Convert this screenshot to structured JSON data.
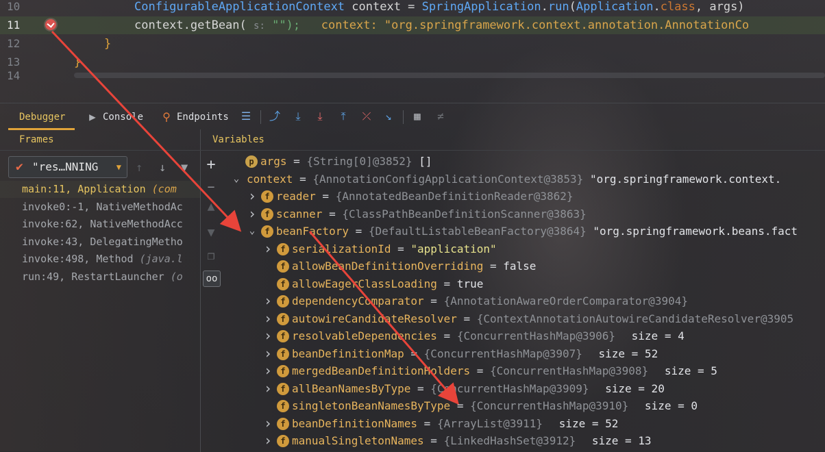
{
  "editor": {
    "lines": [
      {
        "num": "10",
        "text": "ConfigurableApplicationContext context = SpringApplication.run(Application.class, args)"
      },
      {
        "num": "11",
        "code_main": "context.getBean(",
        "param_hint": "s:",
        "code_arg": "\"\");",
        "inline_value": "context: \"org.springframework.context.annotation.AnnotationCo"
      },
      {
        "num": "12",
        "text": "}"
      },
      {
        "num": "13",
        "text": "}"
      },
      {
        "num": "14",
        "text": ""
      }
    ]
  },
  "toolbar": {
    "tabs": [
      "Debugger",
      "Console",
      "Endpoints"
    ]
  },
  "frames": {
    "header": "Frames",
    "thread": "\"res…NNING",
    "items": [
      {
        "main": "main:11, Application",
        "detail": "(com"
      },
      {
        "main": "invoke0:-1, NativeMethodAc",
        "detail": ""
      },
      {
        "main": "invoke:62, NativeMethodAcc",
        "detail": ""
      },
      {
        "main": "invoke:43, DelegatingMetho",
        "detail": ""
      },
      {
        "main": "invoke:498, Method",
        "detail": "(java.l"
      },
      {
        "main": "run:49, RestartLauncher",
        "detail": "(o"
      }
    ]
  },
  "variables": {
    "header": "Variables",
    "items": [
      {
        "name": "args",
        "type": "{String[0]@3852}",
        "value": "[]",
        "icon": "p",
        "tw": ""
      },
      {
        "name": "context",
        "type": "{AnnotationConfigApplicationContext@3853}",
        "value": "\"org.springframework.context.",
        "icon": "",
        "tw": "v"
      },
      {
        "name": "reader",
        "type": "{AnnotatedBeanDefinitionReader@3862}",
        "value": "",
        "icon": "f",
        "tw": ">"
      },
      {
        "name": "scanner",
        "type": "{ClassPathBeanDefinitionScanner@3863}",
        "value": "",
        "icon": "f",
        "tw": ">"
      },
      {
        "name": "beanFactory",
        "type": "{DefaultListableBeanFactory@3864}",
        "value": "\"org.springframework.beans.fact",
        "icon": "f",
        "tw": "v"
      },
      {
        "name": "serializationId",
        "type": "",
        "value": "\"application\"",
        "icon": "f",
        "tw": ">"
      },
      {
        "name": "allowBeanDefinitionOverriding",
        "type": "",
        "value": "false",
        "icon": "f",
        "tw": ""
      },
      {
        "name": "allowEagerClassLoading",
        "type": "",
        "value": "true",
        "icon": "f",
        "tw": ""
      },
      {
        "name": "dependencyComparator",
        "type": "{AnnotationAwareOrderComparator@3904}",
        "value": "",
        "icon": "f",
        "tw": ">"
      },
      {
        "name": "autowireCandidateResolver",
        "type": "{ContextAnnotationAutowireCandidateResolver@3905",
        "value": "",
        "icon": "f",
        "tw": ">"
      },
      {
        "name": "resolvableDependencies",
        "type": "{ConcurrentHashMap@3906}",
        "value": "size = 4",
        "icon": "f",
        "tw": ">"
      },
      {
        "name": "beanDefinitionMap",
        "type": "{ConcurrentHashMap@3907}",
        "value": "size = 52",
        "icon": "f",
        "tw": ">"
      },
      {
        "name": "mergedBeanDefinitionHolders",
        "type": "{ConcurrentHashMap@3908}",
        "value": "size = 5",
        "icon": "f",
        "tw": ">"
      },
      {
        "name": "allBeanNamesByType",
        "type": "{ConcurrentHashMap@3909}",
        "value": "size = 20",
        "icon": "f",
        "tw": ">"
      },
      {
        "name": "singletonBeanNamesByType",
        "type": "{ConcurrentHashMap@3910}",
        "value": "size = 0",
        "icon": "f",
        "tw": ""
      },
      {
        "name": "beanDefinitionNames",
        "type": "{ArrayList@3911}",
        "value": "size = 52",
        "icon": "f",
        "tw": ">"
      },
      {
        "name": "manualSingletonNames",
        "type": "{LinkedHashSet@3912}",
        "value": "size = 13",
        "icon": "f",
        "tw": ">"
      }
    ]
  },
  "colors": {
    "accent": "#e0a33a",
    "arrow": "#e8443a"
  }
}
